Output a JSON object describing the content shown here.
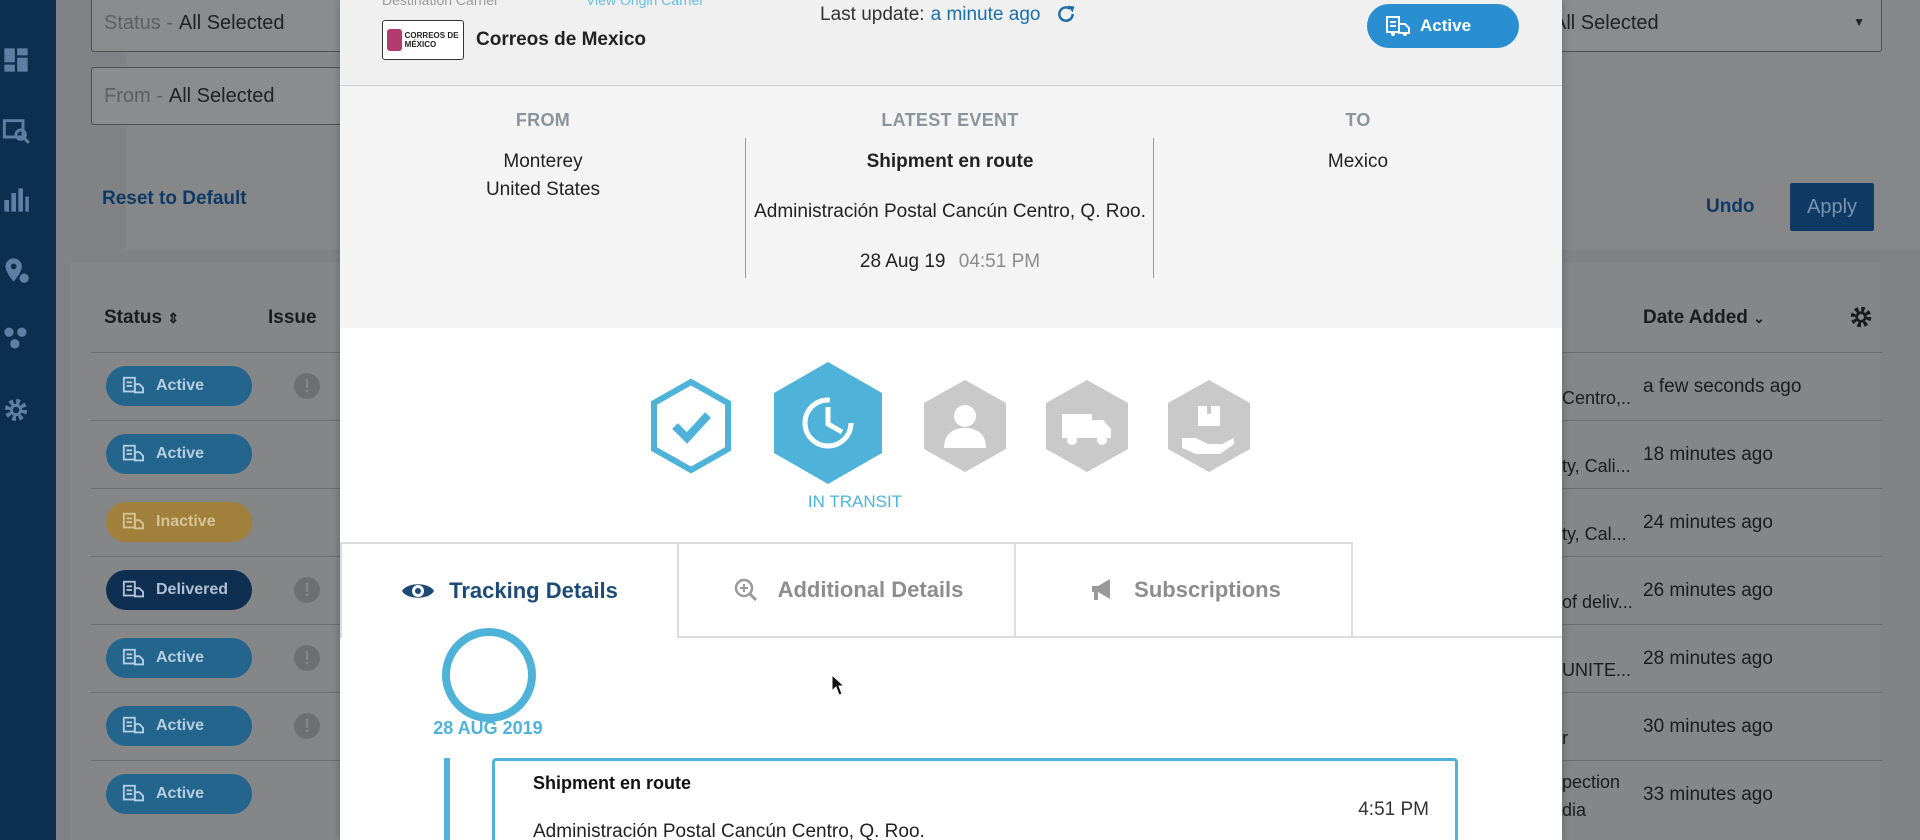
{
  "background": {
    "filters": {
      "status": {
        "label": "Status -",
        "value": "All Selected"
      },
      "right_select": {
        "value": "All Selected"
      },
      "from": {
        "label": "From -",
        "value": "All Selected"
      }
    },
    "reset_label": "Reset to Default",
    "undo_label": "Undo",
    "apply_label": "Apply",
    "table": {
      "columns": {
        "status": "Status",
        "issue": "Issue",
        "date_added": "Date Added"
      },
      "rows": [
        {
          "status": "Active",
          "destination": "Centro,...",
          "date": "a few seconds ago"
        },
        {
          "status": "Active",
          "destination": "ty, Cali...",
          "date": "18 minutes ago"
        },
        {
          "status": "Inactive",
          "destination": "ty, Cal...",
          "date": "24 minutes ago"
        },
        {
          "status": "Delivered",
          "destination": "of deliv...",
          "date": "26 minutes ago"
        },
        {
          "status": "Active",
          "destination": "UNITE...",
          "date": "28 minutes ago"
        },
        {
          "status": "Active",
          "destination": "r",
          "date": "30 minutes ago"
        },
        {
          "status": "Active",
          "destination": "pection",
          "destination2": "dia",
          "date": "33 minutes ago"
        }
      ]
    }
  },
  "modal": {
    "header": {
      "dest_carrier_label": "Destination Carrier",
      "view_origin_label": "View Origin Carrier",
      "logo_text": "CORREOS DE MÉXICO",
      "carrier_name": "Correos de Mexico",
      "last_update_label": "Last update:",
      "last_update_value": "a minute ago",
      "status_pill": "Active"
    },
    "summary": {
      "from": {
        "heading": "FROM",
        "city": "Monterey",
        "country": "United States"
      },
      "latest": {
        "heading": "LATEST EVENT",
        "title": "Shipment en route",
        "location": "Administración Postal Cancún Centro, Q. Roo.",
        "date": "28 Aug 19",
        "time": "04:51 PM"
      },
      "to": {
        "heading": "TO",
        "place": "Mexico"
      }
    },
    "stage_label": "IN TRANSIT",
    "tabs": [
      {
        "label": "Tracking Details",
        "icon": "eye-icon"
      },
      {
        "label": "Additional Details",
        "icon": "search-plus-icon"
      },
      {
        "label": "Subscriptions",
        "icon": "megaphone-icon"
      }
    ],
    "timeline": {
      "date": "28 AUG 2019",
      "event_title": "Shipment en route",
      "event_time": "4:51 PM",
      "event_location": "Administración Postal Cancún Centro, Q. Roo."
    }
  },
  "colors": {
    "accent": "#4fb3d9",
    "navy": "#0d2f4f",
    "pill": "#2a8fd0",
    "inactive_hex": "#c9c9c9"
  }
}
